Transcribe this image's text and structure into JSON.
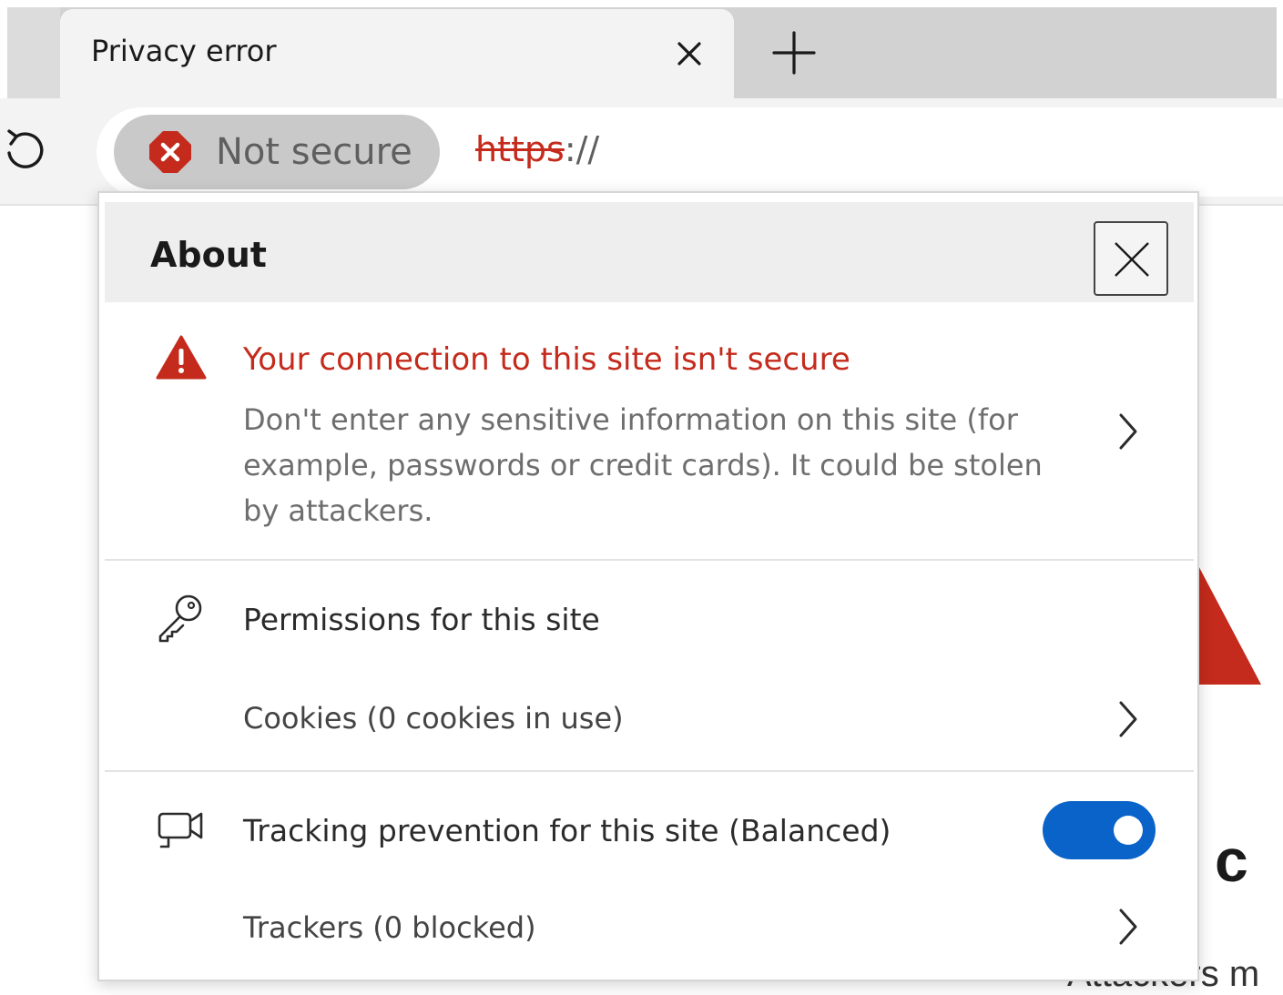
{
  "browser": {
    "tab": {
      "title": "Privacy error",
      "close_icon": "close-icon"
    },
    "new_tab_icon": "plus-icon",
    "refresh_icon": "refresh-icon",
    "address_bar": {
      "security_chip_label": "Not secure",
      "security_icon": "error-circle-icon",
      "url_scheme": "https",
      "url_rest": "://"
    }
  },
  "flyout": {
    "title": "About",
    "close_icon": "close-icon",
    "connection": {
      "icon": "warning-triangle-icon",
      "title": "Your connection to this site isn't secure",
      "description": "Don't enter any sensitive information on this site (for example, passwords or credit cards). It could be stolen by attackers."
    },
    "permissions": {
      "icon": "key-icon",
      "heading": "Permissions for this site",
      "cookies_label": "Cookies (0 cookies in use)"
    },
    "tracking": {
      "icon": "tracking-camera-icon",
      "heading": "Tracking prevention for this site (Balanced)",
      "toggle_on": true,
      "trackers_label": "Trackers (0 blocked)"
    }
  },
  "page_behind": {
    "heading_fragment": "r c",
    "subtext_fragment": "Attackers m"
  },
  "colors": {
    "error_red": "#c42b1c",
    "toggle_blue": "#0a63c9",
    "chip_gray": "#c9c9c9"
  }
}
